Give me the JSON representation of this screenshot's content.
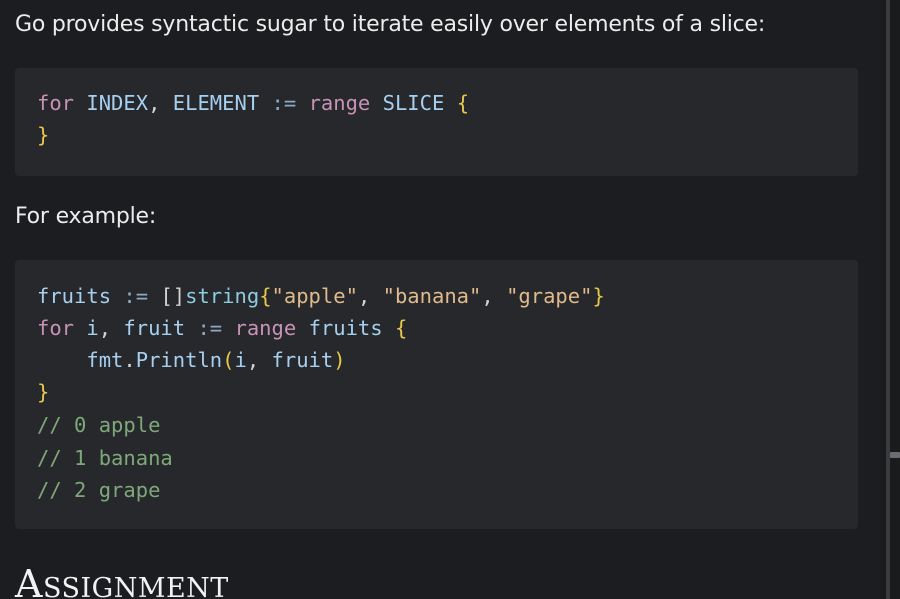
{
  "intro_text": "Go provides syntactic sugar to iterate easily over elements of a slice:",
  "syntax_block": {
    "line1": {
      "kw_for": "for",
      "index": "INDEX",
      "comma": ",",
      "element": "ELEMENT",
      "assign": ":=",
      "kw_range": "range",
      "slice": "SLICE",
      "open_brace": "{"
    },
    "line2": {
      "close_brace": "}"
    }
  },
  "example_label": "For example:",
  "example_block": {
    "line1": {
      "var": "fruits",
      "assign": ":=",
      "brackets": "[]",
      "type": "string",
      "open": "{",
      "s1": "\"apple\"",
      "c1": ",",
      "s2": "\"banana\"",
      "c2": ",",
      "s3": "\"grape\"",
      "close": "}"
    },
    "line2": {
      "kw_for": "for",
      "i": "i",
      "comma": ",",
      "fruit": "fruit",
      "assign": ":=",
      "kw_range": "range",
      "fruits": "fruits",
      "open_brace": "{"
    },
    "line3": {
      "pkg": "fmt",
      "dot": ".",
      "func": "Println",
      "open_paren": "(",
      "arg1": "i",
      "comma": ",",
      "arg2": "fruit",
      "close_paren": ")"
    },
    "line4": {
      "close_brace": "}"
    },
    "comments": [
      "// 0 apple",
      "// 1 banana",
      "// 2 grape"
    ]
  },
  "section_heading": "Assignment",
  "colors": {
    "background": "#1c1d20",
    "code_background": "#26282b",
    "keyword": "#c792b6",
    "identifier": "#a6cff0",
    "brace": "#e8c84a",
    "string": "#e0b98c",
    "comment": "#7fa87a"
  }
}
